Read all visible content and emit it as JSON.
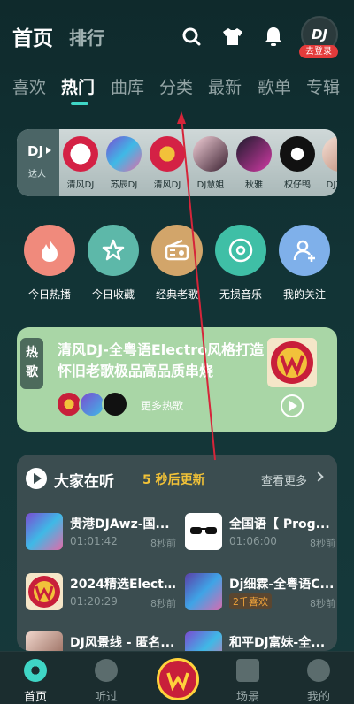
{
  "header": {
    "tab_home": "首页",
    "tab_rank": "排行",
    "avatar_text": "DJ",
    "login_badge": "去登录"
  },
  "sub_tabs": [
    "喜欢",
    "热门",
    "曲库",
    "分类",
    "最新",
    "歌单",
    "专辑"
  ],
  "dj_card": {
    "tag": "DJ",
    "sub": "达人",
    "items": [
      "清风DJ",
      "苏辰DJ",
      "清风DJ",
      "DJ慧姐",
      "秋雅",
      "权仔鸭",
      "DJ文杰"
    ]
  },
  "quick_actions": [
    "今日热播",
    "今日收藏",
    "经典老歌",
    "无损音乐",
    "我的关注"
  ],
  "hot": {
    "tag": "热歌",
    "title": "清风DJ-全粤语Electro风格打造怀旧老歌极品高品质串烧",
    "more": "更多热歌"
  },
  "listening": {
    "title": "大家在听",
    "update": "5 秒后更新",
    "more": "查看更多",
    "songs": [
      {
        "title": "贵港DJAwz-国...",
        "duration": "01:01:42",
        "ago": "8秒前"
      },
      {
        "title": "全国语【 Prog...",
        "duration": "01:06:00",
        "ago": "8秒前"
      },
      {
        "title": "2024精选Elect...",
        "duration": "01:20:29",
        "ago": "8秒前"
      },
      {
        "title": "Dj细霖-全粤语C...",
        "badge": "2千喜欢",
        "ago": "8秒前"
      },
      {
        "title": "DJ风景线 - 匿名...",
        "duration": "",
        "ago": ""
      },
      {
        "title": "和平Dj富妹-全...",
        "duration": "",
        "ago": ""
      }
    ]
  },
  "bottom_nav": {
    "home": "首页",
    "history": "听过",
    "scene": "场景",
    "mine": "我的"
  },
  "colors": {
    "accent": "#3fd6c6",
    "hot_card": "#a9d6a6",
    "update_text": "#f2c237",
    "login_badge": "#e33b3b"
  }
}
